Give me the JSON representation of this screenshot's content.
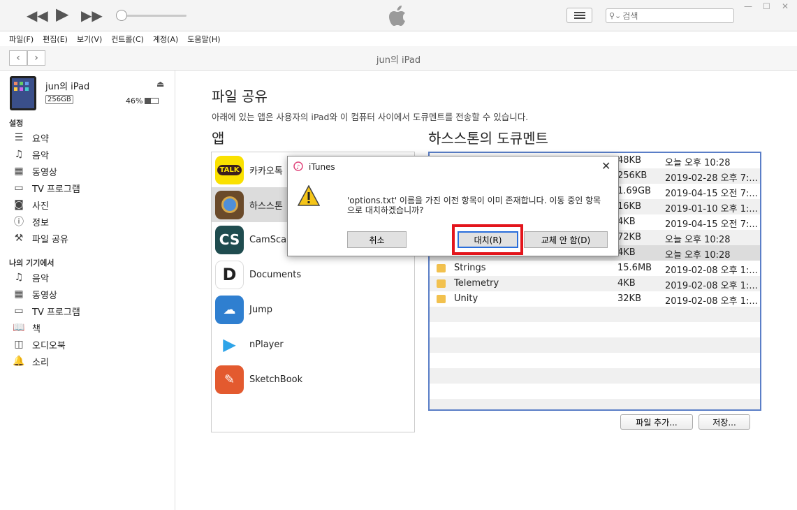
{
  "player": {
    "search_placeholder": "검색"
  },
  "menu": [
    "파일(F)",
    "편집(E)",
    "보기(V)",
    "컨트롤(C)",
    "계정(A)",
    "도움말(H)"
  ],
  "nav": {
    "title": "jun의 iPad"
  },
  "device": {
    "name": "jun의 iPad",
    "capacity": "256GB",
    "battery": "46%"
  },
  "sidebar": {
    "settings_header": "설정",
    "settings": [
      {
        "label": "요약",
        "icon": "summary-icon"
      },
      {
        "label": "음악",
        "icon": "music-note-icon"
      },
      {
        "label": "동영상",
        "icon": "film-icon"
      },
      {
        "label": "TV 프로그램",
        "icon": "tv-icon"
      },
      {
        "label": "사진",
        "icon": "camera-icon"
      },
      {
        "label": "정보",
        "icon": "info-icon"
      },
      {
        "label": "파일 공유",
        "icon": "file-sharing-icon"
      }
    ],
    "on_device_header": "나의 기기에서",
    "on_device": [
      {
        "label": "음악",
        "icon": "music-note-icon"
      },
      {
        "label": "동영상",
        "icon": "film-icon"
      },
      {
        "label": "TV 프로그램",
        "icon": "tv-icon"
      },
      {
        "label": "책",
        "icon": "book-icon"
      },
      {
        "label": "오디오북",
        "icon": "audiobook-icon"
      },
      {
        "label": "소리",
        "icon": "bell-icon"
      }
    ]
  },
  "main": {
    "title": "파일 공유",
    "description": "아래에 있는 앱은 사용자의 iPad와 이 컴퓨터 사이에서 도큐멘트를 전송할 수 있습니다.",
    "apps_header": "앱",
    "docs_header": "하스스톤의 도큐멘트",
    "apps": [
      "카카오톡",
      "하스스톤",
      "CamScanner",
      "Documents",
      "Jump",
      "nPlayer",
      "SketchBook"
    ],
    "docs": [
      {
        "name": "",
        "size": "48KB",
        "date": "오늘 오후 10:28"
      },
      {
        "name": "",
        "size": "256KB",
        "date": "2019-02-28 오후 7:..."
      },
      {
        "name": "",
        "size": "1.69GB",
        "date": "2019-04-15 오전 7:..."
      },
      {
        "name": "",
        "size": "16KB",
        "date": "2019-01-10 오후 1:..."
      },
      {
        "name": "",
        "size": "4KB",
        "date": "2019-04-15 오전 7:..."
      },
      {
        "name": "",
        "size": "72KB",
        "date": "오늘 오후 10:28"
      },
      {
        "name": "",
        "size": "4KB",
        "date": "오늘 오후 10:28"
      },
      {
        "name": "Strings",
        "size": "15.6MB",
        "date": "2019-02-08 오후 1:..."
      },
      {
        "name": "Telemetry",
        "size": "4KB",
        "date": "2019-02-08 오후 1:..."
      },
      {
        "name": "Unity",
        "size": "32KB",
        "date": "2019-02-08 오후 1:..."
      }
    ],
    "add_file_button": "파일 추가...",
    "save_button": "저장..."
  },
  "dialog": {
    "title": "iTunes",
    "message": "'options.txt' 이름을 가진 이전 항목이 이미 존재합니다. 이동 중인 항목으로 대치하겠습니까?",
    "cancel": "취소",
    "replace": "대치(R)",
    "dont_replace": "교체 안 함(D)"
  }
}
